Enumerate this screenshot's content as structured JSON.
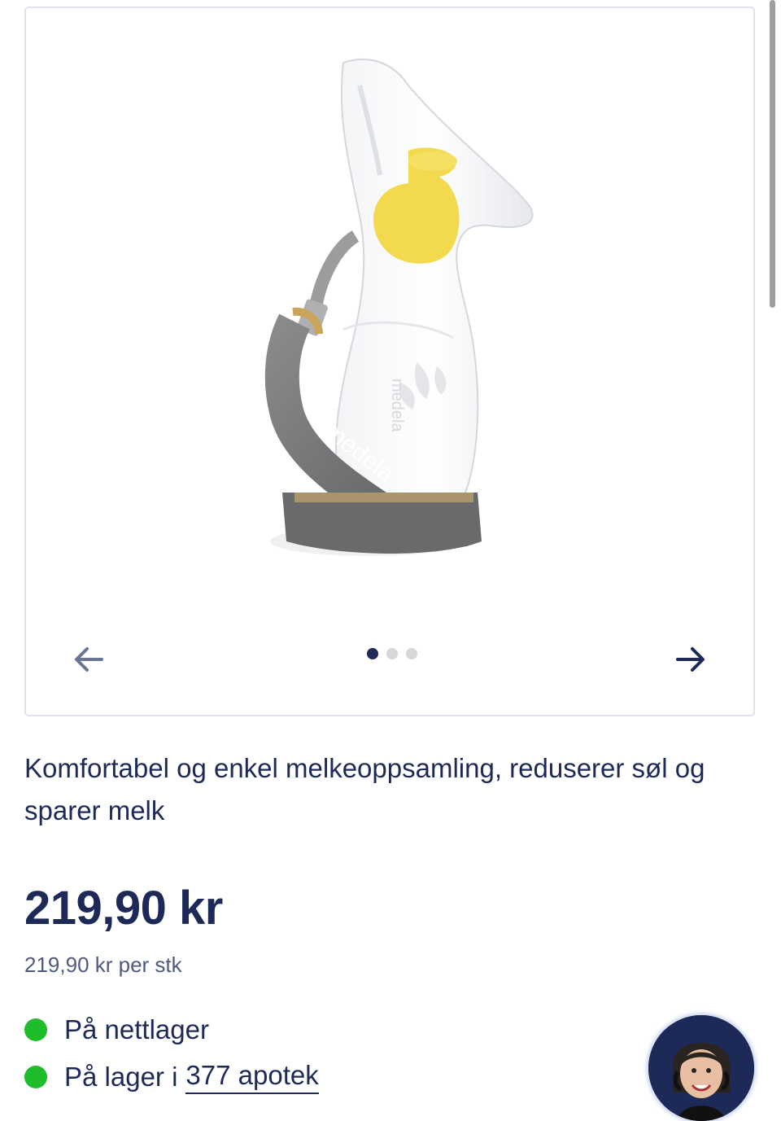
{
  "gallery": {
    "image_brand_text": "medela",
    "dots_count": 3,
    "active_dot": 1,
    "icons": {
      "prev": "arrow-left-icon",
      "next": "arrow-right-icon"
    }
  },
  "product": {
    "description": "Komfortabel og enkel melkeoppsamling, reduserer søl og sparer melk",
    "price": "219,90 kr",
    "unit_price": "219,90 kr per stk"
  },
  "stock": {
    "online": "På nettlager",
    "stores_prefix": "På lager i",
    "stores_link": "377 apotek",
    "status_color": "#1fbd2c"
  },
  "colors": {
    "text_primary": "#1d2a57",
    "text_secondary": "#4f5b7e",
    "border": "#dfe2ea",
    "accent_yellow": "#f4d94a"
  }
}
